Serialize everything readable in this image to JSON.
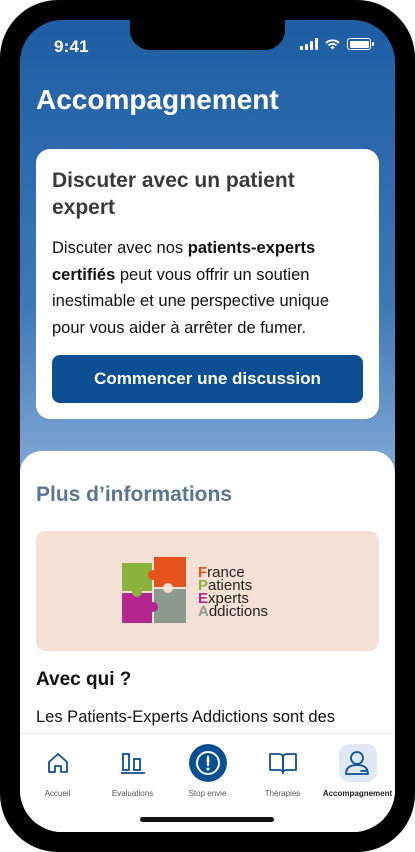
{
  "status": {
    "time": "9:41"
  },
  "header": {
    "title": "Accompagnement"
  },
  "card": {
    "title": "Discuter avec un patient expert",
    "body_prefix": "Discuter avec nos ",
    "body_bold": "patients-experts certifiés",
    "body_suffix": " peut vous offrir un soutien inestimable et une perspective unique pour vous aider à arrêter de fumer.",
    "button_label": "Commencer une discussion"
  },
  "info": {
    "section_title": "Plus d’informations",
    "logo": {
      "line1_cap": "F",
      "line1_rest": "rance",
      "line2_cap": "P",
      "line2_rest": "atients",
      "line3_cap": "E",
      "line3_rest": "xperts",
      "line4_cap": "A",
      "line4_rest": "ddictions"
    },
    "subheading": "Avec qui ?",
    "paragraph": "Les Patients-Experts Addictions sont des"
  },
  "tabs": [
    {
      "label": "Accueil",
      "icon": "home-icon"
    },
    {
      "label": "Evaluations",
      "icon": "bar-chart-icon"
    },
    {
      "label": "Stop envie",
      "icon": "alert-icon"
    },
    {
      "label": "Thérapies",
      "icon": "book-icon"
    },
    {
      "label": "Accompagnement",
      "icon": "user-support-icon"
    }
  ],
  "colors": {
    "primary": "#0d4f93",
    "section_title": "#5b7593",
    "banner_bg": "#f4e0d5",
    "logo_f": "#e5541c",
    "logo_p": "#8ab33b",
    "logo_e": "#b3268f",
    "logo_a": "#8c9a8d"
  }
}
